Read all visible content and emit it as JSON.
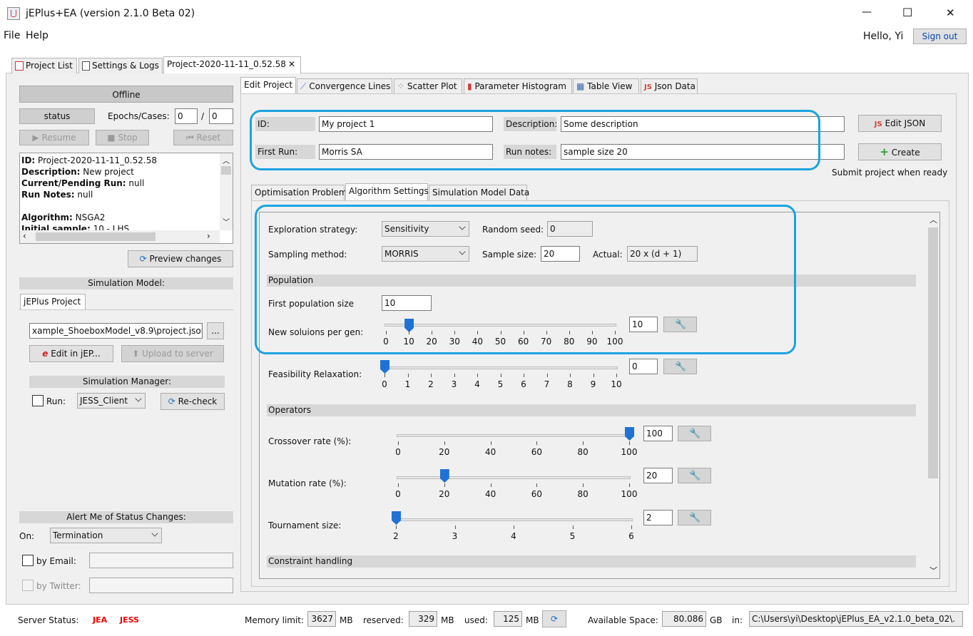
{
  "window": {
    "title": "jEPlus+EA (version 2.1.0 Beta 02)",
    "minimize": "—",
    "maximize": "☐",
    "close": "✕"
  },
  "menu": {
    "file": "File",
    "help": "Help",
    "greeting": "Hello, Yi",
    "signout": "Sign out"
  },
  "top_tabs": [
    "Project List",
    "Settings & Logs",
    "Project-2020-11-11_0.52.58"
  ],
  "left": {
    "status_banner": "Offline",
    "status_button": "status",
    "epochs_label": "Epochs/Cases:",
    "epochs_value": "0",
    "epochs_sep": "/",
    "cases_value": "0",
    "resume": "Resume",
    "stop": "Stop",
    "reset": "Reset",
    "info": {
      "id_k": "ID:",
      "id_v": " Project-2020-11-11_0.52.58",
      "desc_k": "Description:",
      "desc_v": " New project",
      "run_k": "Current/Pending Run:",
      "run_v": " null",
      "notes_k": "Run Notes:",
      "notes_v": " null",
      "alg_k": "Algorithm:",
      "alg_v": " NSGA2",
      "init_k": "Initial sample:",
      "init_v": " 10 - LHS"
    },
    "preview": "Preview changes",
    "sim_model_header": "Simulation Model:",
    "jeplus_tab": "jEPlus Project",
    "project_path": "xample_ShoeboxModel_v8.9\\project.json",
    "browse": "...",
    "edit_jep": "Edit in jEP...",
    "upload": "Upload to server",
    "sim_manager_header": "Simulation Manager:",
    "run_label": "Run:",
    "run_client": "JESS_Client",
    "recheck": "Re-check",
    "alert_header": "Alert Me of Status Changes:",
    "on_label": "On:",
    "on_value": "Termination",
    "by_email": "by Email:",
    "by_twitter": "by Twitter:"
  },
  "right_tabs": [
    "Edit Project",
    "Convergence Lines",
    "Scatter Plot",
    "Parameter Histogram",
    "Table View",
    "Json Data"
  ],
  "project": {
    "id_label": "ID:",
    "id_value": "My project 1",
    "desc_label": "Description:",
    "desc_value": "Some description",
    "first_run_label": "First Run:",
    "first_run_value": "Morris SA",
    "run_notes_label": "Run notes:",
    "run_notes_value": "sample size 20",
    "edit_json": "Edit JSON",
    "create": "Create",
    "submit_note": "Submit project when ready"
  },
  "sub_tabs": [
    "Optimisation Problem",
    "Algorithm Settings",
    "Simulation Model Data"
  ],
  "algo": {
    "exploration_label": "Exploration strategy:",
    "exploration_value": "Sensitivity",
    "seed_label": "Random seed:",
    "seed_value": "0",
    "sampling_label": "Sampling method:",
    "sampling_value": "MORRIS",
    "sample_size_label": "Sample size:",
    "sample_size_value": "20",
    "actual_label": "Actual:",
    "actual_value": "20 x (d + 1)",
    "population_header": "Population",
    "first_pop_label": "First population size",
    "first_pop_value": "10",
    "new_sol_label": "New soluions per gen:",
    "new_sol_value": "10",
    "new_sol_level": 10,
    "new_sol_ticks": [
      "0",
      "10",
      "20",
      "30",
      "40",
      "50",
      "60",
      "70",
      "80",
      "90",
      "100"
    ],
    "feas_label": "Feasibility Relaxation:",
    "feas_value": "0",
    "feas_level": 0,
    "feas_ticks": [
      "0",
      "1",
      "2",
      "3",
      "4",
      "5",
      "6",
      "7",
      "8",
      "9",
      "10"
    ],
    "operators_header": "Operators",
    "crossover_label": "Crossover rate (%):",
    "crossover_value": "100",
    "crossover_level": 100,
    "crossover_ticks": [
      "0",
      "20",
      "40",
      "60",
      "80",
      "100"
    ],
    "mutation_label": "Mutation rate (%):",
    "mutation_value": "20",
    "mutation_level": 20,
    "mutation_ticks": [
      "0",
      "20",
      "40",
      "60",
      "80",
      "100"
    ],
    "tournament_label": "Tournament size:",
    "tournament_value": "2",
    "tournament_level": 2,
    "tournament_ticks": [
      "2",
      "3",
      "4",
      "5",
      "6"
    ],
    "constraint_header": "Constraint handling"
  },
  "status_bar": {
    "server_label": "Server Status:",
    "jea": "JEA",
    "jess": "JESS",
    "mem_label": "Memory limit:",
    "mem_value": "3627",
    "mem_unit": "MB",
    "reserved_label": "reserved:",
    "reserved_value": "329",
    "reserved_unit": "MB",
    "used_label": "used:",
    "used_value": "125",
    "used_unit": "MB",
    "space_label": "Available Space:",
    "space_value": "80.086",
    "space_unit": "GB",
    "in_label": "in:",
    "path_value": "C:\\Users\\yi\\Desktop\\jEPlus_EA_v2.1.0_beta_02\\."
  },
  "colors": {
    "highlight": "#1aa3e2",
    "slider_thumb": "#1f72d6",
    "status_red": "#e00000"
  }
}
